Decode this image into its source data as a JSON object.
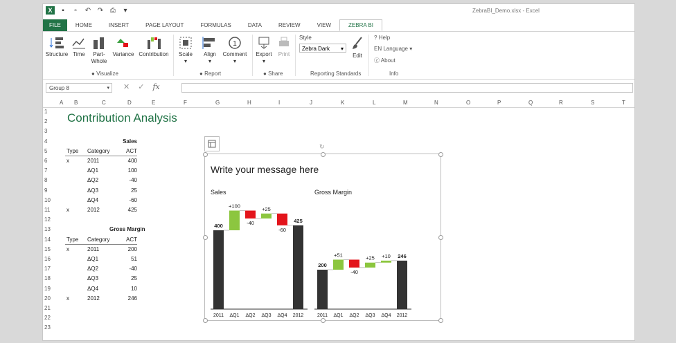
{
  "window": {
    "title": "ZebraBI_Demo.xlsx - Excel"
  },
  "tabs": [
    "FILE",
    "HOME",
    "INSERT",
    "PAGE LAYOUT",
    "FORMULAS",
    "DATA",
    "REVIEW",
    "VIEW",
    "ZEBRA BI"
  ],
  "ribbon": {
    "visualize": {
      "structure": "Structure",
      "time": "Time",
      "part_whole_1": "Part-",
      "part_whole_2": "Whole",
      "variance": "Variance",
      "contribution": "Contribution",
      "label": "Visualize"
    },
    "report": {
      "scale": "Scale",
      "align": "Align",
      "comment": "Comment",
      "label": "Report"
    },
    "share": {
      "export": "Export",
      "print": "Print",
      "label": "Share"
    },
    "standards": {
      "style_label": "Style",
      "style_value": "Zebra Dark",
      "edit": "Edit",
      "label": "Reporting Standards"
    },
    "info": {
      "help": "Help",
      "language": "Language",
      "lang_code": "EN",
      "about": "About",
      "label": "Info"
    }
  },
  "formula_bar": {
    "name_box": "Group 8",
    "fx": "fx"
  },
  "columns": [
    "A",
    "B",
    "C",
    "D",
    "E",
    "F",
    "G",
    "H",
    "I",
    "J",
    "K",
    "L",
    "M",
    "N",
    "O",
    "P",
    "Q",
    "R",
    "S",
    "T"
  ],
  "rows": [
    "1",
    "2",
    "3",
    "4",
    "5",
    "6",
    "7",
    "8",
    "9",
    "10",
    "11",
    "12",
    "13",
    "14",
    "15",
    "16",
    "17",
    "18",
    "19",
    "20",
    "21",
    "22",
    "23"
  ],
  "sheet": {
    "heading": "Contribution Analysis",
    "sales": {
      "title": "Sales",
      "headers": [
        "Type",
        "Category",
        "ACT"
      ],
      "rows": [
        [
          "x",
          "2011",
          "400"
        ],
        [
          "",
          "ΔQ1",
          "100"
        ],
        [
          "",
          "ΔQ2",
          "-40"
        ],
        [
          "",
          "ΔQ3",
          "25"
        ],
        [
          "",
          "ΔQ4",
          "-60"
        ],
        [
          "x",
          "2012",
          "425"
        ]
      ]
    },
    "gm": {
      "title": "Gross Margin",
      "headers": [
        "Type",
        "Category",
        "ACT"
      ],
      "rows": [
        [
          "x",
          "2011",
          "200"
        ],
        [
          "",
          "ΔQ1",
          "51"
        ],
        [
          "",
          "ΔQ2",
          "-40"
        ],
        [
          "",
          "ΔQ3",
          "25"
        ],
        [
          "",
          "ΔQ4",
          "10"
        ],
        [
          "x",
          "2012",
          "246"
        ]
      ]
    }
  },
  "chart_message": "Write your message here",
  "chart_data": [
    {
      "type": "bar",
      "title": "Sales",
      "categories": [
        "2011",
        "ΔQ1",
        "ΔQ2",
        "ΔQ3",
        "ΔQ4",
        "2012"
      ],
      "values": [
        400,
        100,
        -40,
        25,
        -60,
        425
      ],
      "labels": [
        "400",
        "+100",
        "-40",
        "+25",
        "-60",
        "425"
      ]
    },
    {
      "type": "bar",
      "title": "Gross Margin",
      "categories": [
        "2011",
        "ΔQ1",
        "ΔQ2",
        "ΔQ3",
        "ΔQ4",
        "2012"
      ],
      "values": [
        200,
        51,
        -40,
        25,
        10,
        246
      ],
      "labels": [
        "200",
        "+51",
        "-40",
        "+25",
        "+10",
        "246"
      ]
    }
  ],
  "colors": {
    "total": "#333333",
    "positive": "#8cc63f",
    "negative": "#e3141b",
    "accent": "#217346"
  }
}
